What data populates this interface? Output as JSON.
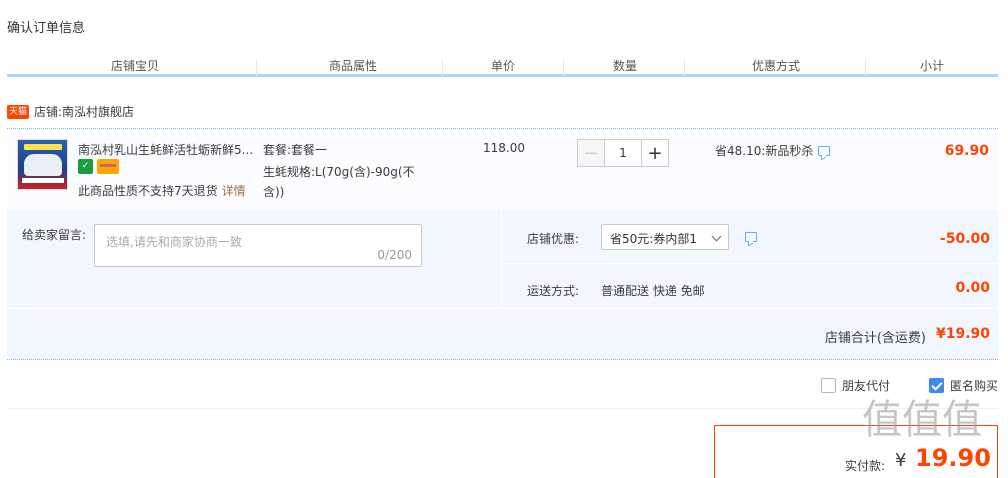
{
  "page": {
    "title": "确认订单信息"
  },
  "columns": [
    "店铺宝贝",
    "商品属性",
    "单价",
    "数量",
    "优惠方式",
    "小计"
  ],
  "shop": {
    "badge": "天猫",
    "label": "店铺:南泓村旗舰店"
  },
  "item": {
    "title": "南泓村乳山生蚝鲜活牡蛎新鲜5...",
    "note": "此商品性质不支持7天退货",
    "detail_link": "详情",
    "attr_set": "套餐:套餐一",
    "attr_spec": "生蚝规格:L(70g(含)-90g(不含))",
    "unit_price": "118.00",
    "qty": "1",
    "discount": "省48.10:新品秒杀",
    "subtotal": "69.90"
  },
  "message": {
    "label": "给卖家留言:",
    "placeholder": "选填,请先和商家协商一致",
    "count": "0/200"
  },
  "shop_discount": {
    "label": "店铺优惠:",
    "selected": "省50元:券内部1",
    "value": "-50.00"
  },
  "shipping": {
    "label": "运送方式:",
    "method": "普通配送 快递 免邮",
    "price": "0.00"
  },
  "shop_total": {
    "label": "店铺合计(含运费)",
    "value": "¥19.90"
  },
  "options": {
    "friend_pay": "朋友代付",
    "anonymous": "匿名购买",
    "anonymous_checked": true,
    "friend_pay_checked": false
  },
  "payment": {
    "label": "实付款:",
    "currency": "¥",
    "amount": "19.90"
  },
  "watermark": "值值值",
  "colors": {
    "accent": "#ff4400",
    "header_line": "#b2d1ff",
    "panel_bg": "#f2f7ff",
    "checkbox": "#3d8af7"
  }
}
